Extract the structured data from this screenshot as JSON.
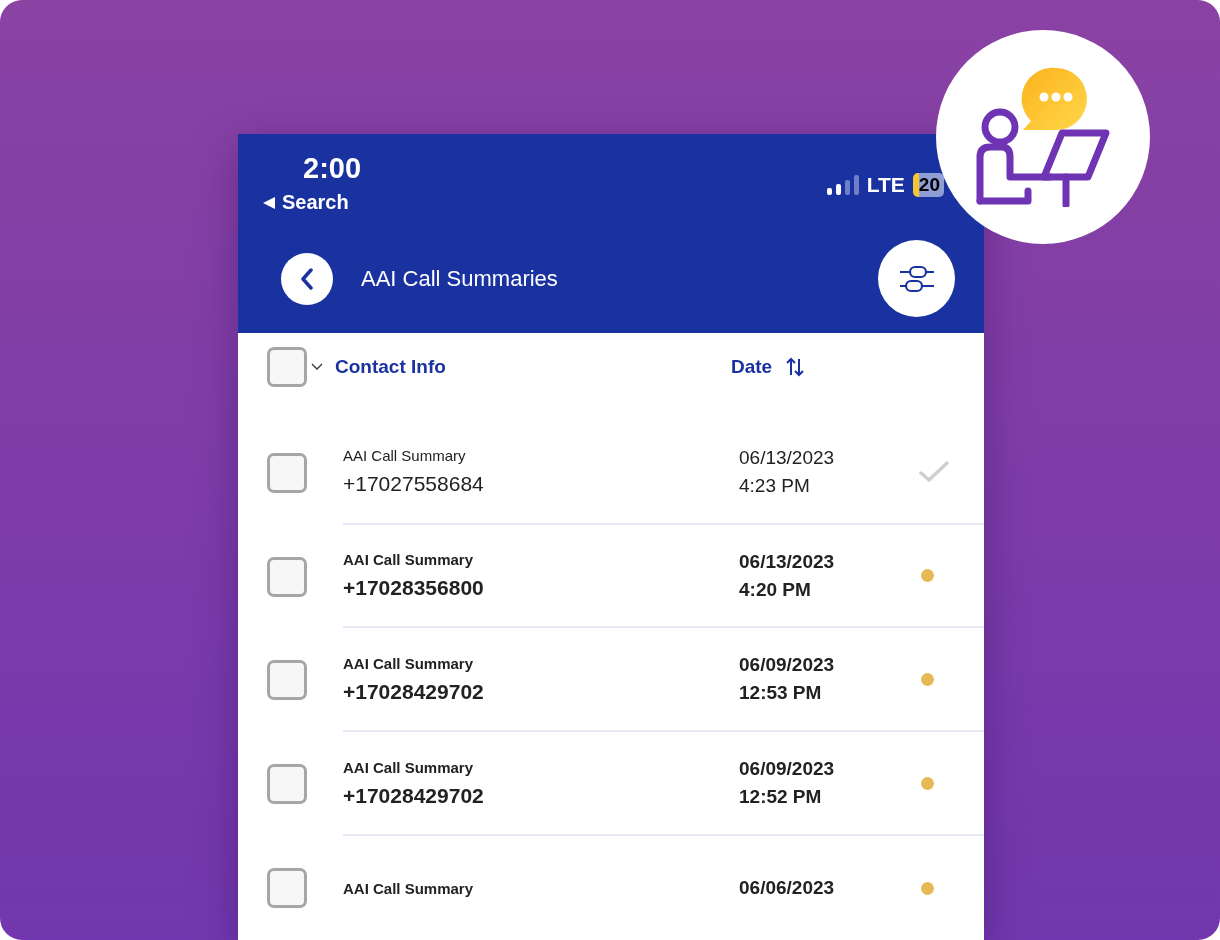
{
  "status_bar": {
    "time": "2:00",
    "back_label": "Search",
    "network": "LTE",
    "battery": "20"
  },
  "nav": {
    "title": "AAI Call Summaries"
  },
  "list_header": {
    "select_all_checked": false,
    "columns": [
      "Contact Info",
      "Date"
    ]
  },
  "rows": [
    {
      "title": "AAI Call Summary",
      "phone": "+17027558684",
      "date": "06/13/2023",
      "time": "4:23 PM",
      "read": true,
      "checked": false
    },
    {
      "title": "AAI Call Summary",
      "phone": "+17028356800",
      "date": "06/13/2023",
      "time": "4:20 PM",
      "read": false,
      "checked": false
    },
    {
      "title": "AAI Call Summary",
      "phone": "+17028429702",
      "date": "06/09/2023",
      "time": "12:53 PM",
      "read": false,
      "checked": false
    },
    {
      "title": "AAI Call Summary",
      "phone": "+17028429702",
      "date": "06/09/2023",
      "time": "12:52 PM",
      "read": false,
      "checked": false
    },
    {
      "title": "AAI Call Summary",
      "date": "06/06/2023",
      "read": false,
      "checked": false
    }
  ]
}
